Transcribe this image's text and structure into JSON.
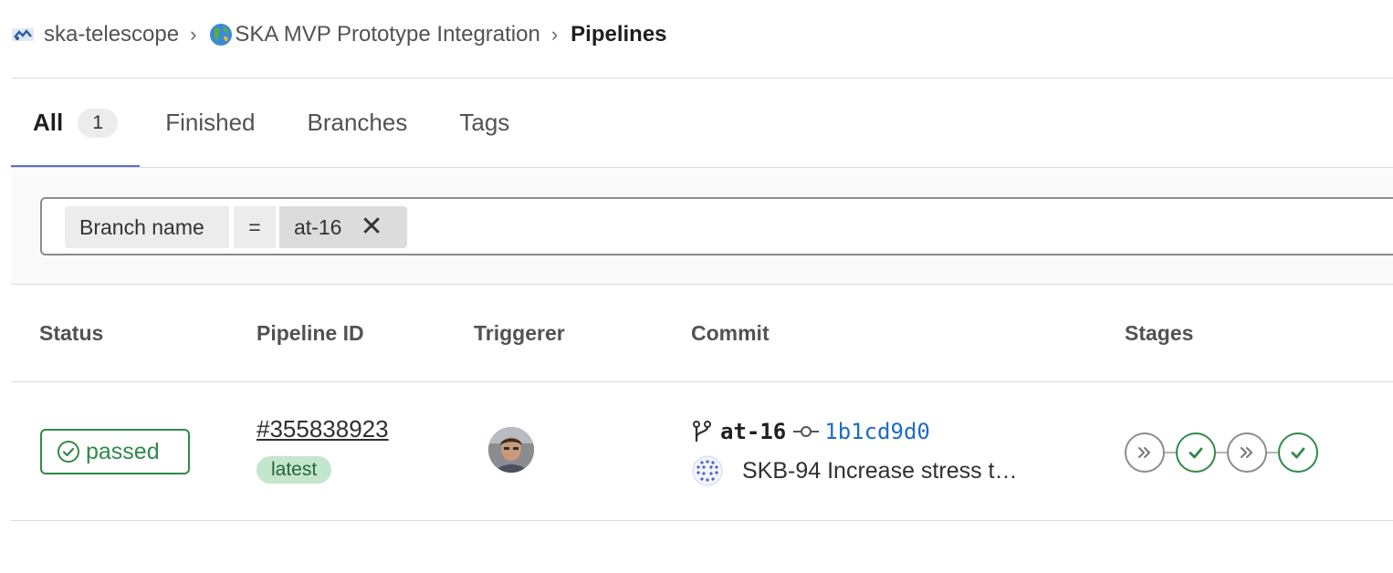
{
  "breadcrumb": {
    "group": "ska-telescope",
    "project": "SKA MVP Prototype Integration",
    "current": "Pipelines",
    "separator": "›"
  },
  "tabs": [
    {
      "label": "All",
      "count": "1",
      "active": true
    },
    {
      "label": "Finished"
    },
    {
      "label": "Branches"
    },
    {
      "label": "Tags"
    }
  ],
  "filter": {
    "token_name": "Branch name",
    "token_operator": "=",
    "token_value": "at-16",
    "remove_glyph": "✕"
  },
  "table": {
    "headers": [
      "Status",
      "Pipeline ID",
      "Triggerer",
      "Commit",
      "Stages"
    ],
    "rows": [
      {
        "status": "passed",
        "pipeline_id": "#355838923",
        "badge": "latest",
        "branch": "at-16",
        "sha": "1b1cd9d0",
        "commit_title": "SKB-94 Increase stress t…",
        "stages": [
          "skipped",
          "success",
          "skipped",
          "success"
        ]
      }
    ]
  },
  "colors": {
    "success": "#2f8a4a",
    "link": "#1f6cc4",
    "tab_underline": "#5b6fc9",
    "skipped": "#8c8c8c"
  },
  "icons": {
    "group_logo": "ska-logo-icon",
    "project_logo": "globe-icon",
    "status": "check-circle-icon",
    "branch": "branch-icon",
    "commit": "commit-icon",
    "commit_author": "identicon-icon",
    "stage_skipped": "double-chevron-icon",
    "stage_success": "check-icon"
  }
}
